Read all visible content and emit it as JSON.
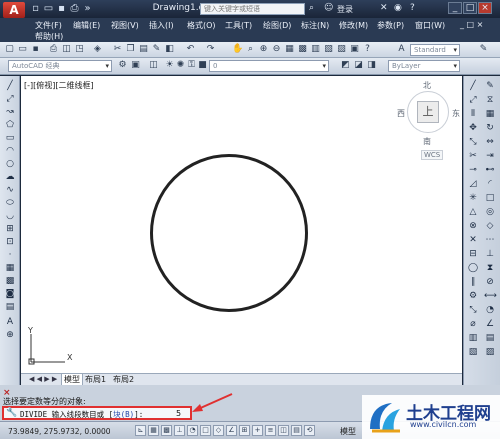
{
  "window": {
    "app_logo_letter": "A",
    "doc_title": "Drawing1.dwg",
    "search_placeholder": "键入关键字或短语",
    "login_label": "登录",
    "help_icon": "?",
    "min_btn": "_",
    "max_btn": "□",
    "close_btn": "×"
  },
  "menu": {
    "items": [
      "文件(F)",
      "编辑(E)",
      "视图(V)",
      "插入(I)",
      "格式(O)",
      "工具(T)",
      "绘图(D)",
      "标注(N)",
      "修改(M)",
      "参数(P)",
      "窗口(W)",
      "帮助(H)"
    ]
  },
  "toolbar": {
    "workspace_combo": "AutoCAD 经典",
    "layer_value": "0",
    "standard_combo": "Standard",
    "bylayer_combo": "ByLayer"
  },
  "viewport": {
    "label": "[-][俯视][二维线框]",
    "compass_north": "北",
    "compass_south": "南",
    "compass_west": "西",
    "compass_east": "东",
    "cube_face": "上",
    "wcs": "WCS",
    "ucs_y": "Y",
    "ucs_x": "X"
  },
  "tabs": {
    "model": "模型",
    "layout1": "布局1",
    "layout2": "布局2",
    "nav": "◀ ◀ ▶ ▶"
  },
  "command": {
    "history": "选择要定数等分的对象:",
    "prompt_prefix": "DIVIDE 输入线段数目或 [",
    "block_option": "块(B)",
    "prompt_suffix": "]:",
    "value": "5"
  },
  "status": {
    "coords": "73.9849, 275.9732, 0.0000",
    "model_label": "模型"
  },
  "watermark": {
    "title": "土木工程网",
    "url": "www.civilcn.com"
  },
  "colors": {
    "title_bg": "#1a2538",
    "highlight_red": "#e03030",
    "canvas_bg": "#ffffff"
  }
}
